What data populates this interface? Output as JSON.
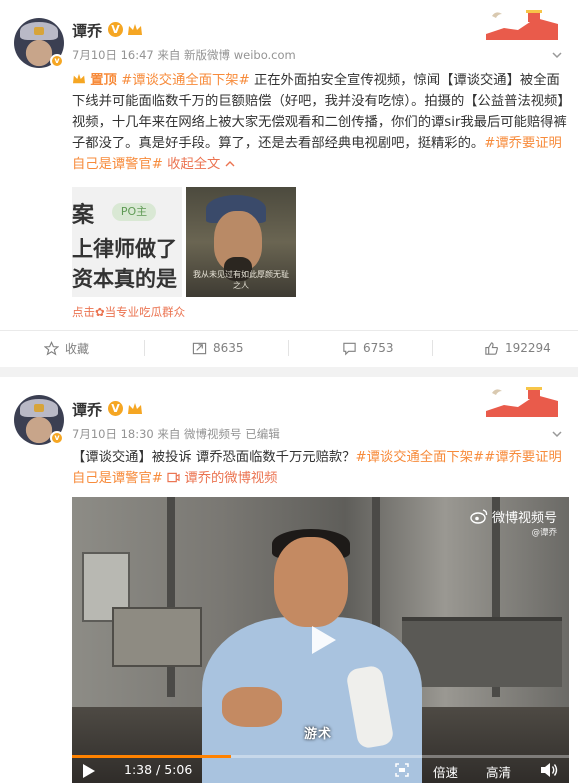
{
  "posts": [
    {
      "username": "谭乔",
      "meta": "7月10日 16:47 来自 新版微博 weibo.com",
      "pinned_label": "置顶",
      "text_topic1": "#谭谈交通全面下架#",
      "text_1": " 正在外面拍安全宣传视频，惊闻【谭谈交通】被全面下线并可能面临数千万的巨额赔偿（好吧，我并没有吃惊）。拍摄的【公益普法视频】视频，十几年来在网络上被大家无偿观看和二创传播，你们的谭sir我最后可能赔得裤子都没了。真是好手段。算了，还是去看部经典电视剧吧，挺精彩的。",
      "text_topic2": "#谭乔要证明自己是谭警官#",
      "collapse_label": "收起全文",
      "thumb1_line1": "案",
      "thumb1_badge": "PO主",
      "thumb1_line2": "上律师做了",
      "thumb1_line3": "资本真的是",
      "thumb2_subtitle": "我从未见过有如此厚颜无耻之人",
      "fans_label": "点击✿当专业吃瓜群众",
      "actions": {
        "favorite": "收藏",
        "repost": "8635",
        "comment": "6753",
        "like": "192294"
      }
    },
    {
      "username": "谭乔",
      "meta": "7月10日 18:30 来自 微博视频号  已编辑",
      "text_1": "【谭谈交通】被投诉 谭乔恐面临数千万元赔款？",
      "text_topic1": "#谭谈交通全面下架#",
      "text_topic2": "#谭乔要证明自己是谭警官#",
      "video_link": "谭乔的微博视频",
      "video": {
        "watermark_title": "微博视频号",
        "watermark_sub": "@谭乔",
        "caption": "游术",
        "time": "1:38 / 5:06",
        "progress": 0.32,
        "speed_label": "倍速",
        "quality_label": "高清"
      }
    }
  ],
  "colors": {
    "topic": "#f78b3b",
    "link": "#eb7350",
    "meta": "#939393",
    "progress": "#ff8200"
  }
}
